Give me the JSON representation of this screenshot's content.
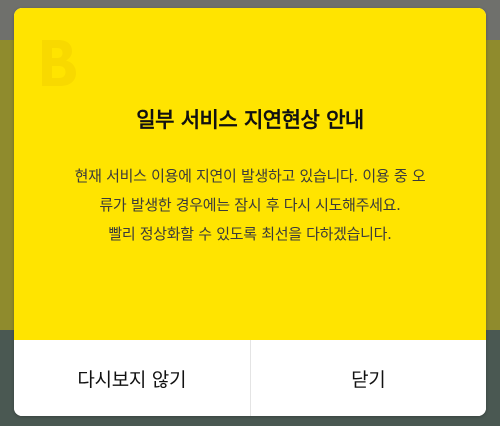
{
  "colors": {
    "dialog_body": "#ffe400",
    "logo": "#f8d900",
    "backdrop_panel": "#8f8b2d",
    "backdrop_bottom": "#4a5852"
  },
  "dialog": {
    "logo_icon": "brand-b-logo-icon",
    "title": "일부 서비스 지연현상 안내",
    "message": {
      "paragraph1": "현재 서비스 이용에 지연이 발생하고 있습니다. 이용 중 오류가 발생한 경우에는 잠시 후 다시 시도해주세요.",
      "paragraph2": "빨리 정상화할 수 있도록 최선을 다하겠습니다."
    },
    "buttons": {
      "dont_show_again": "다시보지 않기",
      "close": "닫기"
    }
  }
}
